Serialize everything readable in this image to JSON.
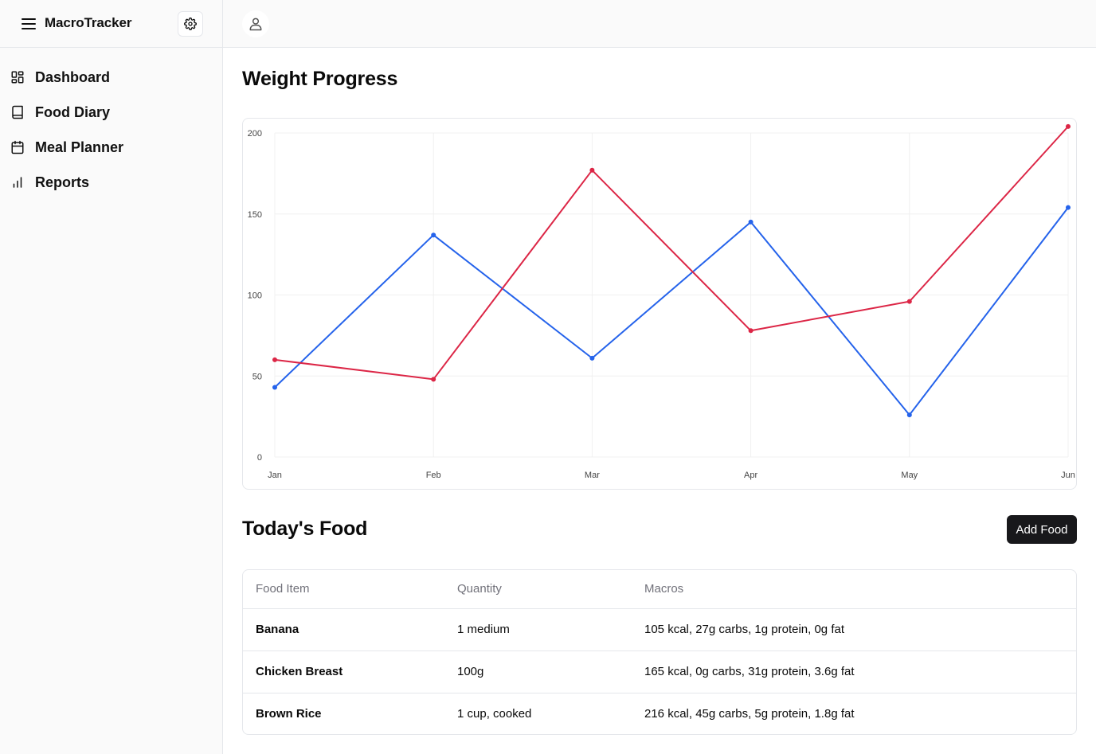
{
  "app": {
    "title": "MacroTracker"
  },
  "sidebar": {
    "items": [
      {
        "label": "Dashboard",
        "icon": "dashboard-icon"
      },
      {
        "label": "Food Diary",
        "icon": "book-icon"
      },
      {
        "label": "Meal Planner",
        "icon": "calendar-icon"
      },
      {
        "label": "Reports",
        "icon": "bar-chart-icon"
      }
    ]
  },
  "weight": {
    "title": "Weight Progress"
  },
  "chart_data": {
    "type": "line",
    "categories": [
      "Jan",
      "Feb",
      "Mar",
      "Apr",
      "May",
      "Jun"
    ],
    "series": [
      {
        "color": "#2563eb",
        "values": [
          43,
          137,
          61,
          145,
          26,
          154
        ]
      },
      {
        "color": "#dc2646",
        "values": [
          60,
          48,
          177,
          78,
          96,
          204
        ]
      }
    ],
    "yticks": [
      "0",
      "50",
      "100",
      "150",
      "200"
    ],
    "ylim": [
      0,
      200
    ],
    "grid": true
  },
  "food": {
    "title": "Today's Food",
    "add_button": "Add Food",
    "columns": [
      "Food Item",
      "Quantity",
      "Macros"
    ],
    "rows": [
      {
        "item": "Banana",
        "quantity": "1 medium",
        "macros": "105 kcal, 27g carbs, 1g protein, 0g fat"
      },
      {
        "item": "Chicken Breast",
        "quantity": "100g",
        "macros": "165 kcal, 0g carbs, 31g protein, 3.6g fat"
      },
      {
        "item": "Brown Rice",
        "quantity": "1 cup, cooked",
        "macros": "216 kcal, 45g carbs, 5g protein, 1.8g fat"
      }
    ]
  }
}
